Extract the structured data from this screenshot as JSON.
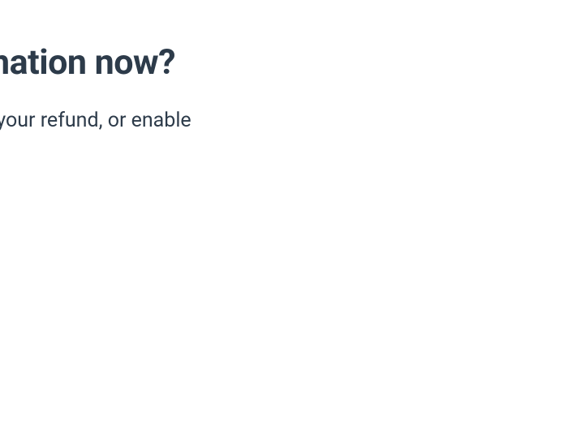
{
  "heading": "account information now?",
  "body_text": "set up direct deposit for your refund, or enable"
}
